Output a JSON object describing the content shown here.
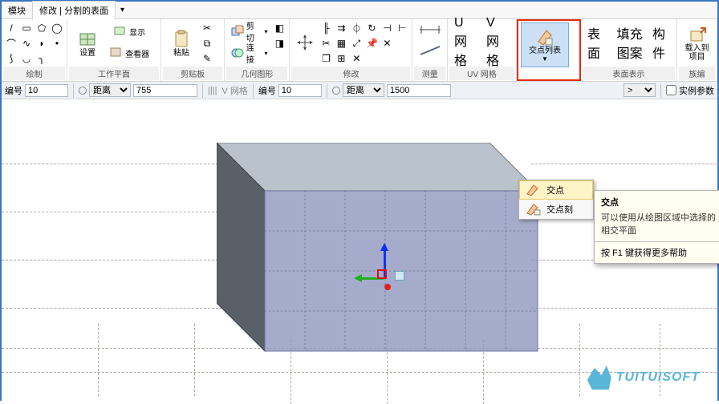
{
  "tabs": {
    "context": "模块",
    "active": "修改 | 分割的表面"
  },
  "ribbon": {
    "groups": {
      "draw": "绘制",
      "workplane": "工作平面",
      "clipboard": "剪贴板",
      "geometry": "几何图形",
      "modify": "修改",
      "measure": "测量",
      "uvgrid": "UV 网格",
      "surface": "表面表示",
      "family": "族编"
    },
    "buttons": {
      "set": "设置",
      "show": "显示",
      "viewer": "查看器",
      "paste": "粘贴",
      "cut": "剪切",
      "join": "连接",
      "ugrid": "U 网格",
      "vgrid": "V 网格",
      "intersect_list": "交点列表",
      "intersect_list_badge": "▼",
      "surface": "表面",
      "fillpattern": "填充图案",
      "component": "构件",
      "loadinto": "载入到\n项目"
    }
  },
  "optbar": {
    "num_label": "编号",
    "num1": "10",
    "distance": "距离",
    "val1": "755",
    "vgrid_label": "V 网格",
    "num2_label": "编号",
    "num2": "10",
    "val2": "1500",
    "suffix_select": ">",
    "instance_param": "实例参数"
  },
  "dropdown": {
    "items": [
      "交点",
      "交点刻"
    ]
  },
  "tooltip": {
    "title": "交点",
    "body": "可以使用从绘图区域中选择的相交平面",
    "foot": "按 F1 键获得更多帮助"
  },
  "watermark": "TUITUISOFT"
}
